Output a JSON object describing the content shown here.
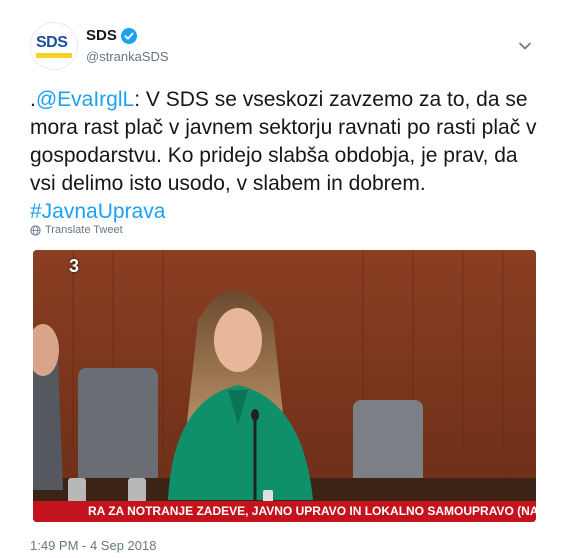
{
  "header": {
    "avatar_text": "SDS",
    "display_name": "SDS",
    "handle": "@strankaSDS",
    "verified_icon": "verified-badge-icon",
    "menu_icon": "chevron-down-icon"
  },
  "tweet": {
    "text_prefix": ".",
    "mention": "@EvaIrglL",
    "text_main": ": V SDS se vseskozi zavzemo za to, da se mora rast plač v javnem sektorju ravnati po rasti plač v gospodarstvu. Ko pridejo slabša obdobja, je prav, da vsi delimo isto usodo, v slabem in dobrem. ",
    "hashtag": "#JavnaUprava"
  },
  "translate": {
    "label": "Translate Tweet"
  },
  "media": {
    "channel": "3",
    "chyron": "RA ZA NOTRANJE ZADEVE, JAVNO UPRAVO IN LOKALNO SAMOUPRAVO (NADALJEVAN..."
  },
  "timestamp": "1:49 PM - 4 Sep 2018",
  "colors": {
    "link": "#1da1f2",
    "brand_blue": "#1a4fa0",
    "brand_yellow": "#f5d327",
    "chyron_red": "#c3141e"
  }
}
